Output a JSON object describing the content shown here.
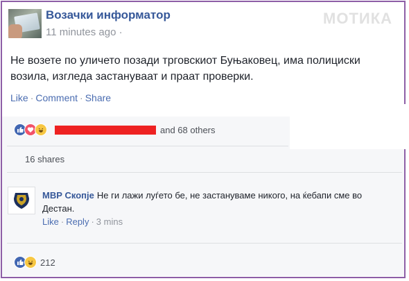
{
  "post": {
    "page_name": "Возачки информатор",
    "timestamp": "11 minutes ago ·",
    "text": "Не возете по уличето позади трговскиот Буњаковец, има полициски возила, изгледа застануваат и праат проверки.",
    "actions": {
      "like": "Like",
      "comment": "Comment",
      "share": "Share"
    }
  },
  "watermark": "МОТИКА",
  "reactions": {
    "icons": [
      "like-icon",
      "love-icon",
      "haha-icon"
    ],
    "others_text": "and 68 others"
  },
  "shares_text": "16 shares",
  "comment": {
    "author": "МВР Скопје",
    "text": "Не ги лажи луѓето бе, не застануваме никого, на ќебапи сме во Дестан.",
    "actions": {
      "like": "Like",
      "reply": "Reply",
      "time": "3 mins"
    }
  },
  "comment_reactions": {
    "icons": [
      "like-icon",
      "haha-icon"
    ],
    "count": "212"
  },
  "colors": {
    "link": "#365899",
    "frame": "#8d5ea6",
    "redaction": "#ee2222",
    "like": "#4267b2",
    "love": "#f25268",
    "haha": "#f7c743"
  }
}
